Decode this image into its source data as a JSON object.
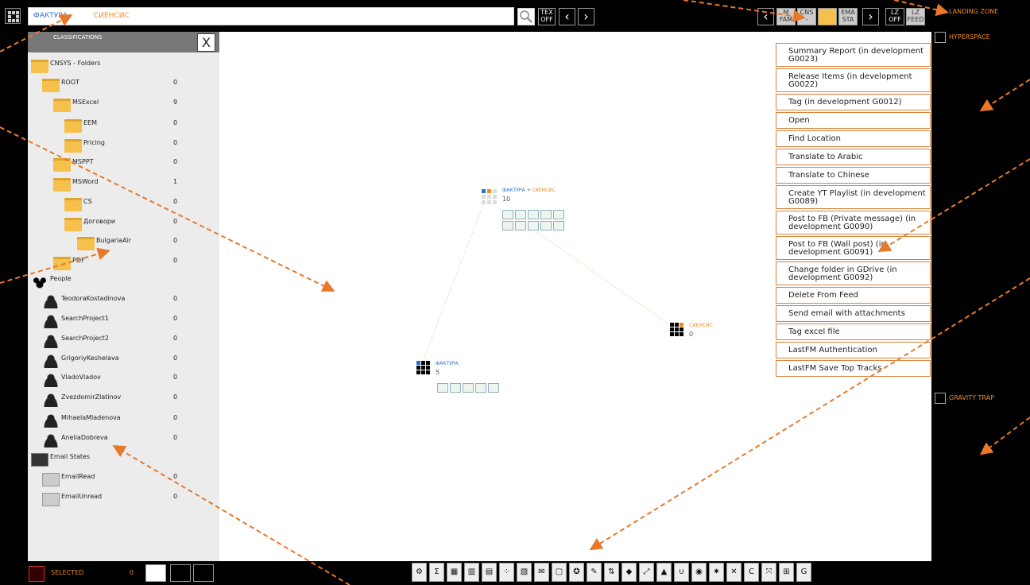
{
  "topbar": {
    "search": {
      "token1": "ФАКТУРА",
      "token2": "СИЕНСИС"
    },
    "text_toggle": "TEX\nOFF",
    "mini_tabs": [
      "M\nFAM",
      "CNS\n-",
      "",
      "EMA\nSTA"
    ],
    "lz_toggle": "LZ\nOFF",
    "lz_feed": "LZ\nFEED",
    "landing_zone": "LANDING ZONE"
  },
  "panel": {
    "title": "CLASSIFICATIONS",
    "close_label": "X",
    "tree": [
      {
        "label": "CNSYS - Folders",
        "type": "folder",
        "level": 0,
        "count": ""
      },
      {
        "label": "ROOT",
        "type": "folder",
        "level": 1,
        "count": "0"
      },
      {
        "label": "MSExcel",
        "type": "folder",
        "level": 2,
        "count": "9"
      },
      {
        "label": "EEM",
        "type": "folder",
        "level": 3,
        "count": "0"
      },
      {
        "label": "Pricing",
        "type": "folder",
        "level": 3,
        "count": "0"
      },
      {
        "label": "MSPPT",
        "type": "folder",
        "level": 2,
        "count": "0"
      },
      {
        "label": "MSWord",
        "type": "folder",
        "level": 2,
        "count": "1"
      },
      {
        "label": "CS",
        "type": "folder",
        "level": 3,
        "count": "0"
      },
      {
        "label": "Договори",
        "type": "folder",
        "level": 3,
        "count": "0"
      },
      {
        "label": "BulgariaAir",
        "type": "folder",
        "level": 4,
        "count": "0"
      },
      {
        "label": "PDF",
        "type": "folder",
        "level": 2,
        "count": "0"
      },
      {
        "label": "People",
        "type": "group",
        "level": 0,
        "count": ""
      },
      {
        "label": "TeodoraKostadinova",
        "type": "person",
        "level": 1,
        "count": "0"
      },
      {
        "label": "SearchProject1",
        "type": "person",
        "level": 1,
        "count": "0"
      },
      {
        "label": "SearchProject2",
        "type": "person",
        "level": 1,
        "count": "0"
      },
      {
        "label": "GrigoriyKeshelava",
        "type": "person",
        "level": 1,
        "count": "0"
      },
      {
        "label": "VladoVladov",
        "type": "person",
        "level": 1,
        "count": "0"
      },
      {
        "label": "ZvezdomirZlatinov",
        "type": "person",
        "level": 1,
        "count": "0"
      },
      {
        "label": "MihaelaMladenova",
        "type": "person",
        "level": 1,
        "count": "0"
      },
      {
        "label": "AneliaDobreva",
        "type": "person",
        "level": 1,
        "count": "0"
      },
      {
        "label": "Email States",
        "type": "mail",
        "level": 0,
        "count": ""
      },
      {
        "label": "EmailRead",
        "type": "mailitem",
        "level": 1,
        "count": "0"
      },
      {
        "label": "EmailUnread",
        "type": "mailitem",
        "level": 1,
        "count": "0"
      }
    ]
  },
  "context_menu": [
    "Summary Report (in development G0023)",
    "Release Items (in development G0022)",
    "Tag (in development G0012)",
    "Open",
    "Find Location",
    "Translate to Arabic",
    "Translate to Chinese",
    "Create YT Playlist (in development G0089)",
    "Post to FB (Private message) (in development G0090)",
    "Post to FB (Wall post) (in development G0091)",
    "Change folder in GDrive (in development G0092)",
    "Delete From Feed",
    "Send email with attachments",
    "Tag excel file",
    "LastFM Authentication",
    "LastFM Save Top Tracks"
  ],
  "graph": {
    "combined": {
      "label_a": "ФАКТУРА",
      "plus": "+",
      "label_b": "СИЕНСИС",
      "count": "10"
    },
    "siensis": {
      "label": "СИЕНСИС",
      "count": "0"
    },
    "faktura": {
      "label": "ФАКТУРА",
      "count": "5"
    }
  },
  "right_panel": {
    "hyperspace": "HYPERSPACE",
    "gravity_trap": "GRAVITY TRAP"
  },
  "bottom": {
    "selected_label": "SELECTED",
    "selected_count": "0",
    "tool_icons": [
      "gear",
      "sigma",
      "grid",
      "table",
      "columns",
      "scatter",
      "list",
      "mail",
      "doc",
      "lifebuoy",
      "brush",
      "sort",
      "tag",
      "expand",
      "image",
      "magnet",
      "eye",
      "sun",
      "close-x",
      "refresh",
      "fullscreen",
      "tree",
      "g"
    ],
    "tool_glyphs": [
      "⚙",
      "Σ",
      "▦",
      "▥",
      "▤",
      "⁘",
      "▧",
      "✉",
      "▢",
      "✪",
      "✎",
      "⇅",
      "◆",
      "⤢",
      "▲",
      "∪",
      "◉",
      "✷",
      "✕",
      "C",
      "⤧",
      "⊞",
      "G"
    ]
  },
  "colors": {
    "accent": "#f08a1c",
    "blue": "#2b6fd1",
    "menu_border": "#d9813b"
  }
}
